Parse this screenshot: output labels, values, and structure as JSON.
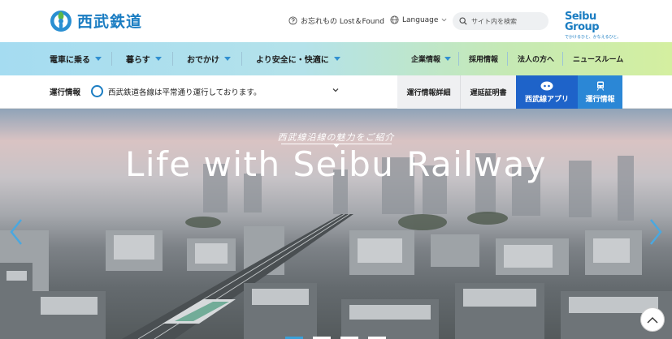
{
  "header": {
    "logo_text": "西武鉄道",
    "lost_found": "お忘れもの Lost＆Found",
    "language": "Language",
    "search_placeholder": "サイト内を検索",
    "group_name": "Seibu Group",
    "group_tagline": "でかけるひと、かなえるひと。"
  },
  "global_nav": {
    "items": [
      {
        "label": "電車に乗る"
      },
      {
        "label": "暮らす"
      },
      {
        "label": "おでかけ"
      },
      {
        "label": "より安全に・快適に"
      }
    ],
    "right_items": [
      {
        "label": "企業情報"
      },
      {
        "label": "採用情報"
      },
      {
        "label": "法人の方へ"
      },
      {
        "label": "ニュースルーム"
      }
    ]
  },
  "status_bar": {
    "label": "運行情報",
    "message": "西武鉄道各線は平常通り運行しております。",
    "buttons": [
      {
        "label": "運行情報詳細"
      },
      {
        "label": "遅延証明書"
      },
      {
        "label": "西武線アプリ"
      },
      {
        "label": "運行情報"
      }
    ]
  },
  "hero": {
    "subtitle": "西武線沿線の魅力をご紹介",
    "title": "Life with Seibu Railway",
    "slide_count": 4,
    "active_slide": 1
  },
  "colors": {
    "brand_blue": "#1b7dc2",
    "app_button": "#1e63c9",
    "status_button": "#2b87d6"
  },
  "icons": [
    "seibu-logo-icon",
    "help-circle-icon",
    "globe-icon",
    "chevron-down-icon",
    "search-icon",
    "smartphone-app-icon",
    "train-icon",
    "arrow-left-icon",
    "arrow-right-icon",
    "arrow-up-icon"
  ]
}
